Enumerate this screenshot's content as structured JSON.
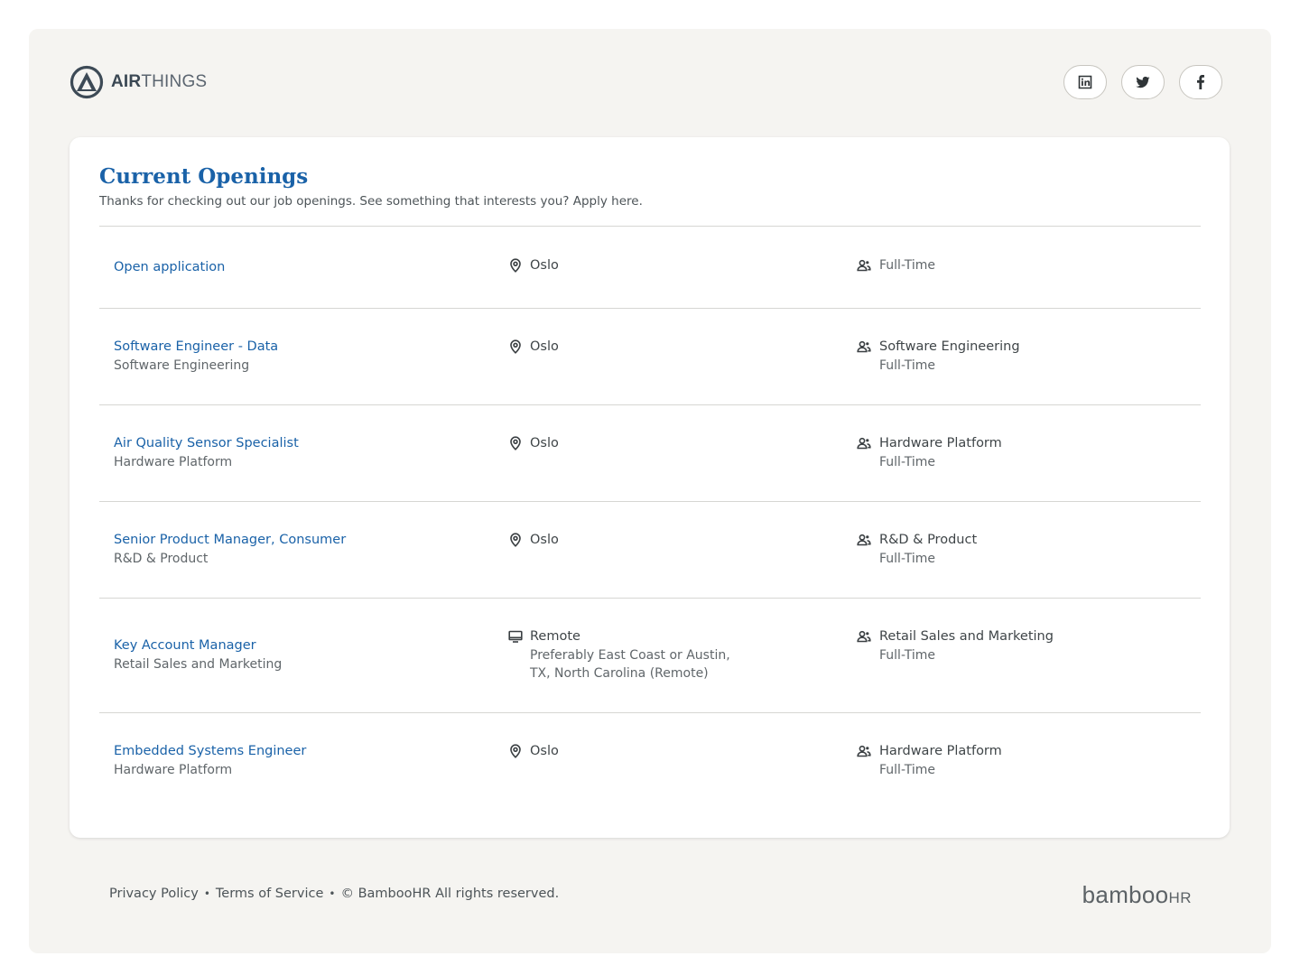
{
  "brand": {
    "name_bold": "AIR",
    "name_light": "THINGS",
    "logo_icon": "airthings-logo-icon"
  },
  "social": [
    {
      "name": "linkedin",
      "icon": "linkedin-icon"
    },
    {
      "name": "twitter",
      "icon": "twitter-icon"
    },
    {
      "name": "facebook",
      "icon": "facebook-icon"
    }
  ],
  "card": {
    "title": "Current Openings",
    "subtitle": "Thanks for checking out our job openings. See something that interests you? Apply here."
  },
  "jobs": [
    {
      "title": "Open application",
      "title_dept": "",
      "location": "Oslo",
      "location_detail": "",
      "location_icon": "map-pin-icon",
      "dept": "Full-Time",
      "employment": ""
    },
    {
      "title": "Software Engineer - Data",
      "title_dept": "Software Engineering",
      "location": "Oslo",
      "location_detail": "",
      "location_icon": "map-pin-icon",
      "dept": "Software Engineering",
      "employment": "Full-Time"
    },
    {
      "title": "Air Quality Sensor Specialist",
      "title_dept": "Hardware Platform",
      "location": "Oslo",
      "location_detail": "",
      "location_icon": "map-pin-icon",
      "dept": "Hardware Platform",
      "employment": "Full-Time"
    },
    {
      "title": "Senior Product Manager, Consumer",
      "title_dept": "R&D & Product",
      "location": "Oslo",
      "location_detail": "",
      "location_icon": "map-pin-icon",
      "dept": "R&D & Product",
      "employment": "Full-Time"
    },
    {
      "title": "Key Account Manager",
      "title_dept": "Retail Sales and Marketing",
      "location": "Remote",
      "location_detail_1": "Preferably East Coast or Austin,",
      "location_detail_2": "TX, North Carolina (Remote)",
      "location_icon": "monitor-icon",
      "dept": "Retail Sales and Marketing",
      "employment": "Full-Time"
    },
    {
      "title": "Embedded Systems Engineer",
      "title_dept": "Hardware Platform",
      "location": "Oslo",
      "location_detail": "",
      "location_icon": "map-pin-icon",
      "dept": "Hardware Platform",
      "employment": "Full-Time"
    }
  ],
  "footer": {
    "privacy": "Privacy Policy",
    "terms": "Terms of Service",
    "separator": "•",
    "copyright": "© BambooHR All rights reserved.",
    "powered_by_main": "bamboo",
    "powered_by_suffix": "HR"
  },
  "colors": {
    "accent": "#1a62a8",
    "page_bg": "#f5f4f1",
    "card_bg": "#ffffff"
  }
}
